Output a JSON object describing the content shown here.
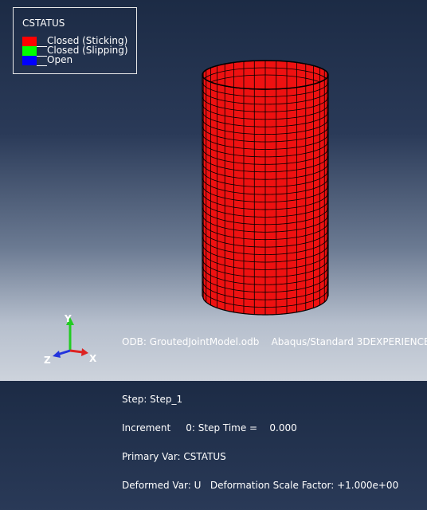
{
  "legend": {
    "title": "CSTATUS",
    "items": [
      {
        "label": "Closed (Sticking)",
        "color": "#ff0000"
      },
      {
        "label": "Closed (Slipping)",
        "color": "#00ff00"
      },
      {
        "label": "Open",
        "color": "#0000ff"
      }
    ]
  },
  "info": {
    "odb_line": "ODB: GroutedJointModel.odb    Abaqus/Standard 3DEXPERIENCE",
    "step_line": "Step: Step_1",
    "increment_line": "Increment     0: Step Time =    0.000",
    "primary_var_line": "Primary Var: CSTATUS",
    "deformed_var_line": "Deformed Var: U   Deformation Scale Factor: +1.000e+00"
  },
  "triad": {
    "y_label": "Y",
    "z_label": "Z",
    "x_label": "X",
    "y_color": "#22cc22",
    "z_color": "#2233dd",
    "x_color": "#dd2222"
  },
  "model": {
    "name": "cylinder-mesh",
    "color": "#ee1111",
    "edge_color": "#000000",
    "status": "Closed (Sticking)"
  }
}
